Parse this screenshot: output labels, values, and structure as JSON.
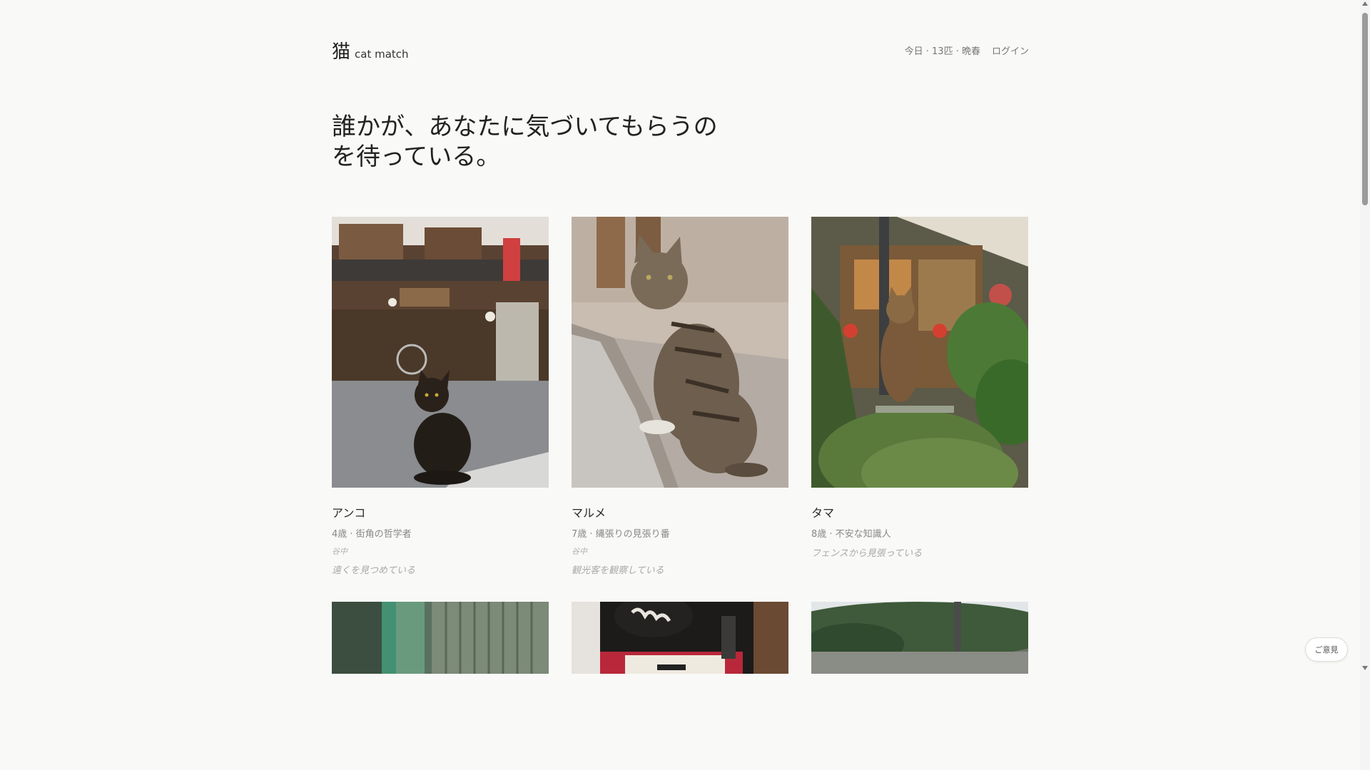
{
  "header": {
    "logo_mark": "猫",
    "logo_text": "cat match",
    "status": "今日 · 13匹 · 晩春",
    "login": "ログイン"
  },
  "hero": {
    "line1": "誰かが、あなたに気づいてもらうの",
    "line2": "を待っている。"
  },
  "cats": [
    {
      "name": "アンコ",
      "meta": "4歳 · 街角の哲学者",
      "place": "谷中",
      "note": "遠くを見つめている"
    },
    {
      "name": "マルメ",
      "meta": "7歳 · 縄張りの見張り番",
      "place": "谷中",
      "note": "観光客を観察している"
    },
    {
      "name": "タマ",
      "meta": "8歳 · 不安な知識人",
      "place": "",
      "note": "フェンスから見張っている"
    }
  ],
  "feedback": "ご意見"
}
